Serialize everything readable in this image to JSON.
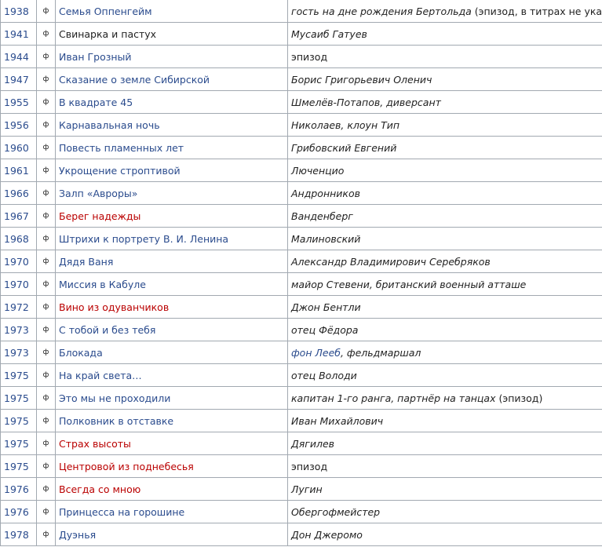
{
  "type_symbol": "ф",
  "rows": [
    {
      "year": "1938",
      "title": "Семья Оппенгейм",
      "link": "blue",
      "role": "гость на дне рождения Бертольда",
      "role_suffix": " (эпизод, в титрах не указан)"
    },
    {
      "year": "1941",
      "title": "Свинарка и пастух",
      "link": "plain",
      "role": "Мусаиб Гатуев"
    },
    {
      "year": "1944",
      "title": "Иван Грозный",
      "link": "blue",
      "role_plain": "эпизод"
    },
    {
      "year": "1947",
      "title": "Сказание о земле Сибирской",
      "link": "blue",
      "role": "Борис Григорьевич Оленич"
    },
    {
      "year": "1955",
      "title": "В квадрате 45",
      "link": "blue",
      "role": "Шмелёв-Потапов, диверсант"
    },
    {
      "year": "1956",
      "title": "Карнавальная ночь",
      "link": "blue",
      "role": "Николаев, клоун Тип"
    },
    {
      "year": "1960",
      "title": "Повесть пламенных лет",
      "link": "blue",
      "role": "Грибовский Евгений"
    },
    {
      "year": "1961",
      "title": "Укрощение строптивой",
      "link": "blue",
      "role": "Люченцио"
    },
    {
      "year": "1966",
      "title": "Залп «Авроры»",
      "link": "blue",
      "role": "Андронников"
    },
    {
      "year": "1967",
      "title": "Берег надежды",
      "link": "red",
      "role": "Ванденберг"
    },
    {
      "year": "1968",
      "title": "Штрихи к портрету В. И. Ленина",
      "link": "blue",
      "role": "Малиновский"
    },
    {
      "year": "1970",
      "title": "Дядя Ваня",
      "link": "blue",
      "role": "Александр Владимирович Серебряков"
    },
    {
      "year": "1970",
      "title": "Миссия в Кабуле",
      "link": "blue",
      "role": "майор Стевени, британский военный атташе"
    },
    {
      "year": "1972",
      "title": "Вино из одуванчиков",
      "link": "red",
      "role": "Джон Бентли"
    },
    {
      "year": "1973",
      "title": "С тобой и без тебя",
      "link": "blue",
      "role": "отец Фёдора"
    },
    {
      "year": "1973",
      "title": "Блокада",
      "link": "blue",
      "role_link": "фон Лееб",
      "role": ", фельдмаршал"
    },
    {
      "year": "1975",
      "title": "На край света…",
      "link": "blue",
      "role": "отец Володи"
    },
    {
      "year": "1975",
      "title": "Это мы не проходили",
      "link": "blue",
      "role": "капитан 1-го ранга, партнёр на танцах",
      "role_suffix": " (эпизод)"
    },
    {
      "year": "1975",
      "title": "Полковник в отставке",
      "link": "blue",
      "role": "Иван Михайлович"
    },
    {
      "year": "1975",
      "title": "Страх высоты",
      "link": "red",
      "role": "Дягилев"
    },
    {
      "year": "1975",
      "title": "Центровой из поднебесья",
      "link": "red",
      "role_plain": "эпизод"
    },
    {
      "year": "1976",
      "title": "Всегда со мною",
      "link": "red",
      "role": "Лугин"
    },
    {
      "year": "1976",
      "title": "Принцесса на горошине",
      "link": "blue",
      "role": "Обергофмейстер"
    },
    {
      "year": "1978",
      "title": "Дуэнья",
      "link": "blue",
      "role": "Дон Джеромо"
    }
  ]
}
